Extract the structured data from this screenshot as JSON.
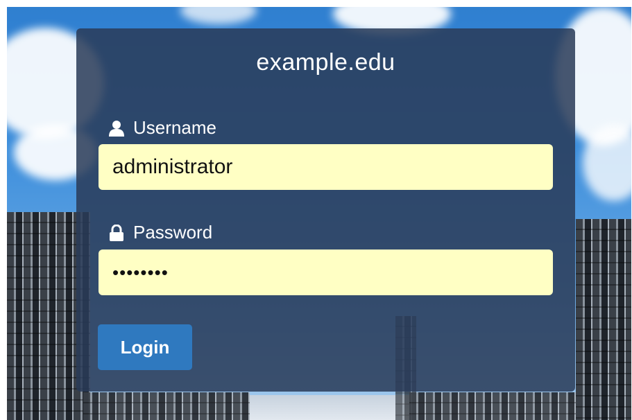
{
  "login": {
    "site_name": "example.edu",
    "username": {
      "label": "Username",
      "value": "administrator",
      "icon": "user-icon"
    },
    "password": {
      "label": "Password",
      "value": "••••••••",
      "icon": "lock-icon"
    },
    "submit_label": "Login"
  },
  "colors": {
    "panel_bg": "#2a3b58",
    "field_bg": "#ffffc4",
    "button_bg": "#2f79bf",
    "text_light": "#ffffff"
  }
}
